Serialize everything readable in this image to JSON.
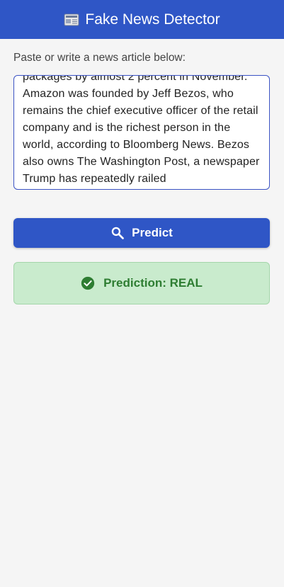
{
  "app_bar": {
    "icon": "newspaper-icon",
    "title": "Fake News Detector"
  },
  "input_section": {
    "label": "Paste or write a news article below:",
    "article_text": "packages by almost 2 percent in November.\nAmazon was founded by Jeff Bezos, who remains the chief executive officer of the retail company and is the richest person in the world, according to Bloomberg News. Bezos also owns The Washington Post, a newspaper Trump has repeatedly railed"
  },
  "predict_button": {
    "icon": "search-icon",
    "label": "Predict"
  },
  "result": {
    "icon": "check-circle-icon",
    "text": "Prediction: REAL",
    "status": "REAL"
  },
  "colors": {
    "primary": "#2f56c6",
    "background": "#f5f5f5",
    "success_bg": "#c9ebcd",
    "success_text": "#2e7d32"
  }
}
